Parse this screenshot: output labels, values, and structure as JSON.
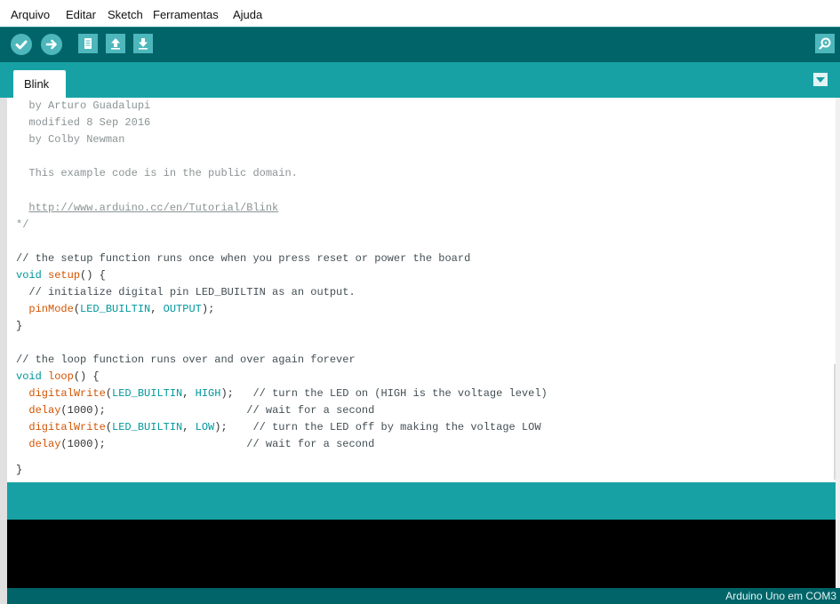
{
  "menu": [
    "Arquivo",
    "Editar",
    "Sketch",
    "Ferramentas",
    "Ajuda"
  ],
  "toolbar": {
    "buttons": [
      {
        "name": "verify",
        "icon": "check-icon"
      },
      {
        "name": "upload",
        "icon": "arrow-right-icon"
      },
      {
        "name": "new",
        "icon": "new-document-icon"
      },
      {
        "name": "open",
        "icon": "arrow-up-icon"
      },
      {
        "name": "save",
        "icon": "arrow-down-icon"
      },
      {
        "name": "serial-monitor",
        "icon": "magnifier-icon"
      }
    ]
  },
  "tabs": [
    {
      "label": "Blink"
    }
  ],
  "editor": {
    "lines": {
      "l1": "  by Arturo Guadalupi",
      "l2": "  modified 8 Sep 2016",
      "l3": "  by Colby Newman",
      "l4": "",
      "l5": "  This example code is in the public domain.",
      "l6": "",
      "l7_prefix": "  ",
      "l7_link": "http://www.arduino.cc/en/Tutorial/Blink",
      "l8": "*/",
      "l9": "",
      "l10": "// the setup function runs once when you press reset or power the board",
      "l11_kw": "void",
      "l11_fn": "setup",
      "l11_rest": "() {",
      "l12": "  // initialize digital pin LED_BUILTIN as an output.",
      "l13_fn": "pinMode",
      "l13_c1": "LED_BUILTIN",
      "l13_c2": "OUTPUT",
      "l14": "}",
      "l15": "",
      "l16": "// the loop function runs over and over again forever",
      "l17_kw": "void",
      "l17_fn": "loop",
      "l17_rest": "() {",
      "l18_fn": "digitalWrite",
      "l18_c1": "LED_BUILTIN",
      "l18_c2": "HIGH",
      "l18_cm": "// turn the LED on (HIGH is the voltage level)",
      "l19_fn": "delay",
      "l19_arg": "1000",
      "l19_cm": "// wait for a second",
      "l20_fn": "digitalWrite",
      "l20_c1": "LED_BUILTIN",
      "l20_c2": "LOW",
      "l20_cm": "// turn the LED off by making the voltage LOW",
      "l21_fn": "delay",
      "l21_arg": "1000",
      "l21_cm": "// wait for a second",
      "l22": "}"
    }
  },
  "status": {
    "text": ""
  },
  "console": {
    "text": ""
  },
  "footer": {
    "board": "Arduino Uno em COM3"
  },
  "colors": {
    "toolbar": "#006468",
    "tabbar": "#17a1a5",
    "button": "#4db7bb",
    "keyword": "#00979c",
    "function": "#d35400",
    "comment": "#8b9394"
  }
}
